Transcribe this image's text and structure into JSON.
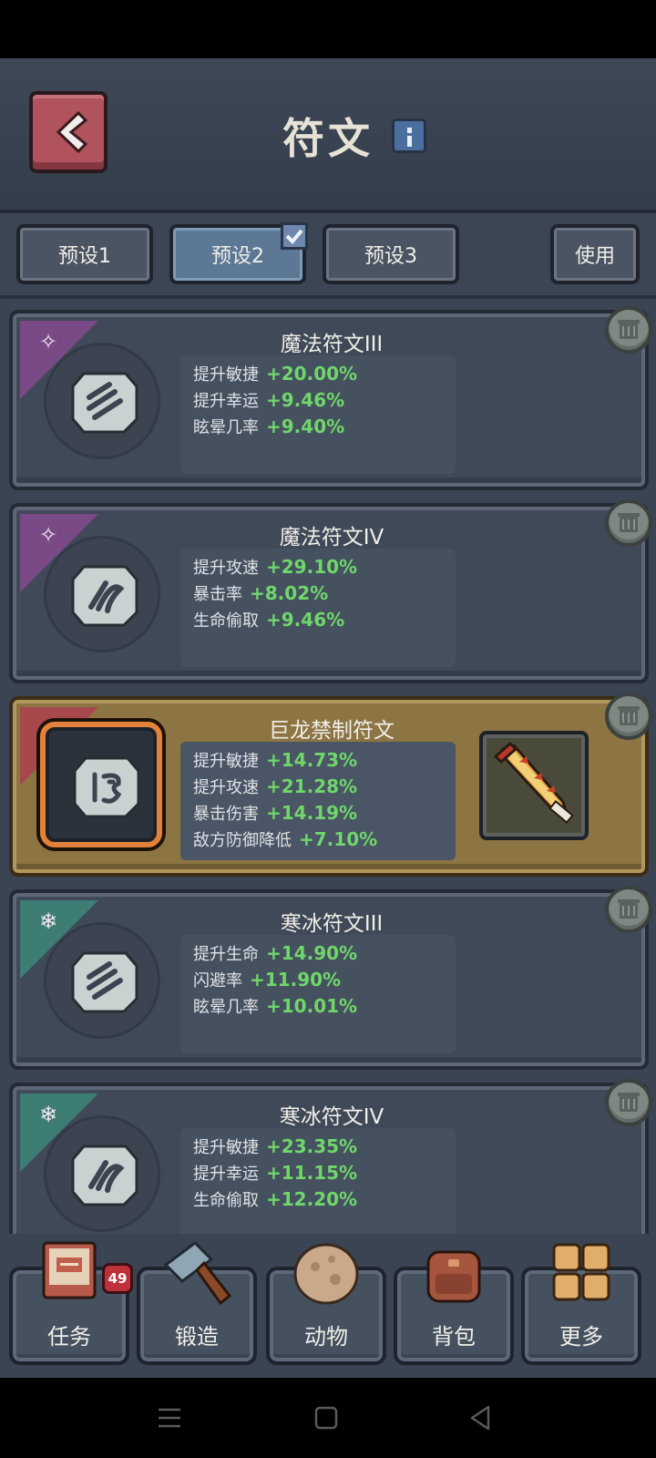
{
  "header": {
    "title": "符文"
  },
  "presets": [
    {
      "label": "预设1",
      "selected": false
    },
    {
      "label": "预设2",
      "selected": true
    },
    {
      "label": "预设3",
      "selected": false
    }
  ],
  "use_label": "使用",
  "runes": [
    {
      "name": "魔法符文III",
      "element": "magic",
      "stats": [
        {
          "label": "提升敏捷",
          "value": "+20.00%"
        },
        {
          "label": "提升幸运",
          "value": "+9.46%"
        },
        {
          "label": "眩晕几率",
          "value": "+9.40%"
        }
      ]
    },
    {
      "name": "魔法符文IV",
      "element": "magic",
      "stats": [
        {
          "label": "提升攻速",
          "value": "+29.10%"
        },
        {
          "label": "暴击率",
          "value": "+8.02%"
        },
        {
          "label": "生命偷取",
          "value": "+9.46%"
        }
      ]
    },
    {
      "name": "巨龙禁制符文",
      "element": "dragon",
      "stats": [
        {
          "label": "提升敏捷",
          "value": "+14.73%"
        },
        {
          "label": "提升攻速",
          "value": "+21.28%"
        },
        {
          "label": "暴击伤害",
          "value": "+14.19%"
        },
        {
          "label": "敌方防御降低",
          "value": "+7.10%"
        }
      ]
    },
    {
      "name": "寒冰符文III",
      "element": "ice",
      "stats": [
        {
          "label": "提升生命",
          "value": "+14.90%"
        },
        {
          "label": "闪避率",
          "value": "+11.90%"
        },
        {
          "label": "眩晕几率",
          "value": "+10.01%"
        }
      ]
    },
    {
      "name": "寒冰符文IV",
      "element": "ice",
      "stats": [
        {
          "label": "提升敏捷",
          "value": "+23.35%"
        },
        {
          "label": "提升幸运",
          "value": "+11.15%"
        },
        {
          "label": "生命偷取",
          "value": "+12.20%"
        }
      ]
    }
  ],
  "bottom_nav": [
    {
      "label": "任务",
      "icon": "quest-book-icon",
      "badge": "49"
    },
    {
      "label": "锻造",
      "icon": "hammer-icon"
    },
    {
      "label": "动物",
      "icon": "egg-icon"
    },
    {
      "label": "背包",
      "icon": "backpack-icon"
    },
    {
      "label": "更多",
      "icon": "grid-icon"
    }
  ],
  "colors": {
    "stat_value": "#6fd76a",
    "magic": "#7a4a86",
    "ice": "#3e7d73",
    "dragon": "#a7484c",
    "featured": "#8c7443"
  }
}
